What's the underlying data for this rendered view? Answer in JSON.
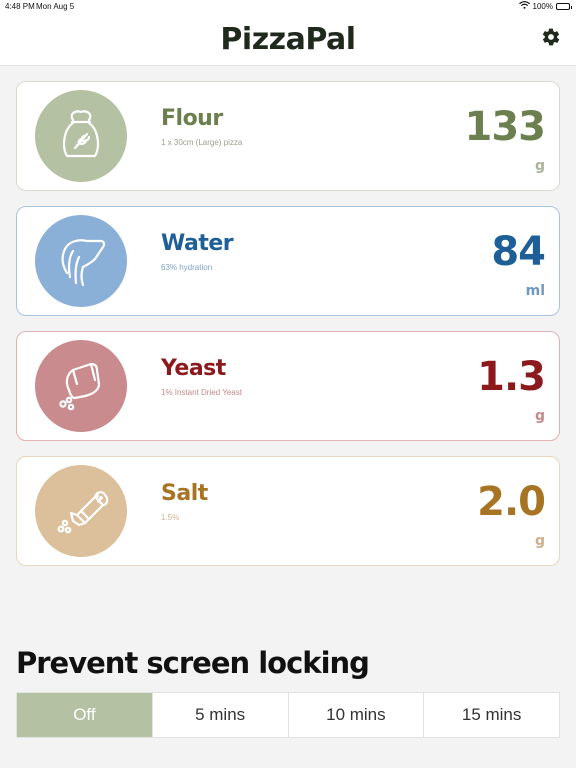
{
  "status_bar": {
    "time": "4:48 PM",
    "date": "Mon Aug 5",
    "battery": "100%"
  },
  "header": {
    "title": "PizzaPal",
    "settings_icon": "gear-icon"
  },
  "ingredients": [
    {
      "name": "Flour",
      "subtitle": "1 x 30cm (Large) pizza",
      "value": "133",
      "unit": "g",
      "icon": "flour-bag-icon",
      "color": "#6b7f4f",
      "circle_color": "#b4c1a3",
      "border_color": "#d9d9d0",
      "subtitle_color": "#9aa08f",
      "unit_color": "#a9b398"
    },
    {
      "name": "Water",
      "subtitle": "63% hydration",
      "value": "84",
      "unit": "ml",
      "icon": "pouring-jug-icon",
      "color": "#1f5f98",
      "circle_color": "#8bb0d8",
      "border_color": "#a9c4e3",
      "subtitle_color": "#7fa2c6",
      "unit_color": "#6f97c3"
    },
    {
      "name": "Yeast",
      "subtitle": "1% Instant Dried Yeast",
      "value": "1.3",
      "unit": "g",
      "icon": "yeast-packet-icon",
      "color": "#8c1a1d",
      "circle_color": "#c98b8d",
      "border_color": "#e2b1b3",
      "subtitle_color": "#c48a8c",
      "unit_color": "#c48a8c"
    },
    {
      "name": "Salt",
      "subtitle": "1.5%",
      "value": "2.0",
      "unit": "g",
      "icon": "salt-shaker-icon",
      "color": "#a77424",
      "circle_color": "#dcc09b",
      "border_color": "#e7d7bf",
      "subtitle_color": "#d0b58f",
      "unit_color": "#cdb088"
    }
  ],
  "screen_lock": {
    "title": "Prevent screen locking",
    "options": [
      "Off",
      "5 mins",
      "10 mins",
      "15 mins"
    ],
    "selected": "Off"
  }
}
